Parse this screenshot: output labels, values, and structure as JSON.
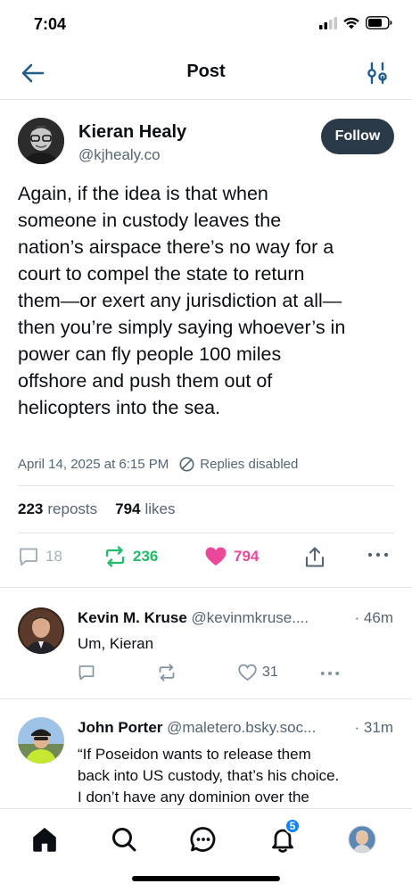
{
  "status_bar": {
    "time": "7:04"
  },
  "header": {
    "title": "Post"
  },
  "post": {
    "author_name": "Kieran Healy",
    "author_handle": "@kjhealy.co",
    "follow_label": "Follow",
    "text": "Again, if the idea is that when\nsomeone in custody leaves the\nnation’s airspace there’s no way for a\ncourt to compel the state to return\nthem—or exert any jurisdiction at all—\nthen you’re simply saying whoever’s in\npower can fly people 100 miles\noffshore and push them out of\nhelicopters into the sea.",
    "timestamp": "April 14, 2025 at 6:15 PM",
    "replies_status": "Replies disabled",
    "reposts_count": "223",
    "reposts_label": "reposts",
    "likes_count": "794",
    "likes_label": "likes",
    "reply_count": "18",
    "repost_count": "236",
    "like_count": "794"
  },
  "replies": [
    {
      "name": "Kevin M. Kruse",
      "handle": "@kevinmkruse....",
      "time": "· 46m",
      "text": "Um, Kieran",
      "like_count": "31"
    },
    {
      "name": "John Porter",
      "handle": "@maletero.bsky.soc...",
      "time": "· 31m",
      "text": "“If Poseidon wants to release them\nback into US custody, that’s his choice.\nI don’t have any dominion over the"
    }
  ],
  "tabbar": {
    "notifications_badge": "5"
  },
  "colors": {
    "repost_green": "#20bc6a",
    "like_pink": "#ec4899",
    "follow_bg": "#2b3a49",
    "accent_blue": "#1083fe",
    "muted": "#566573"
  }
}
